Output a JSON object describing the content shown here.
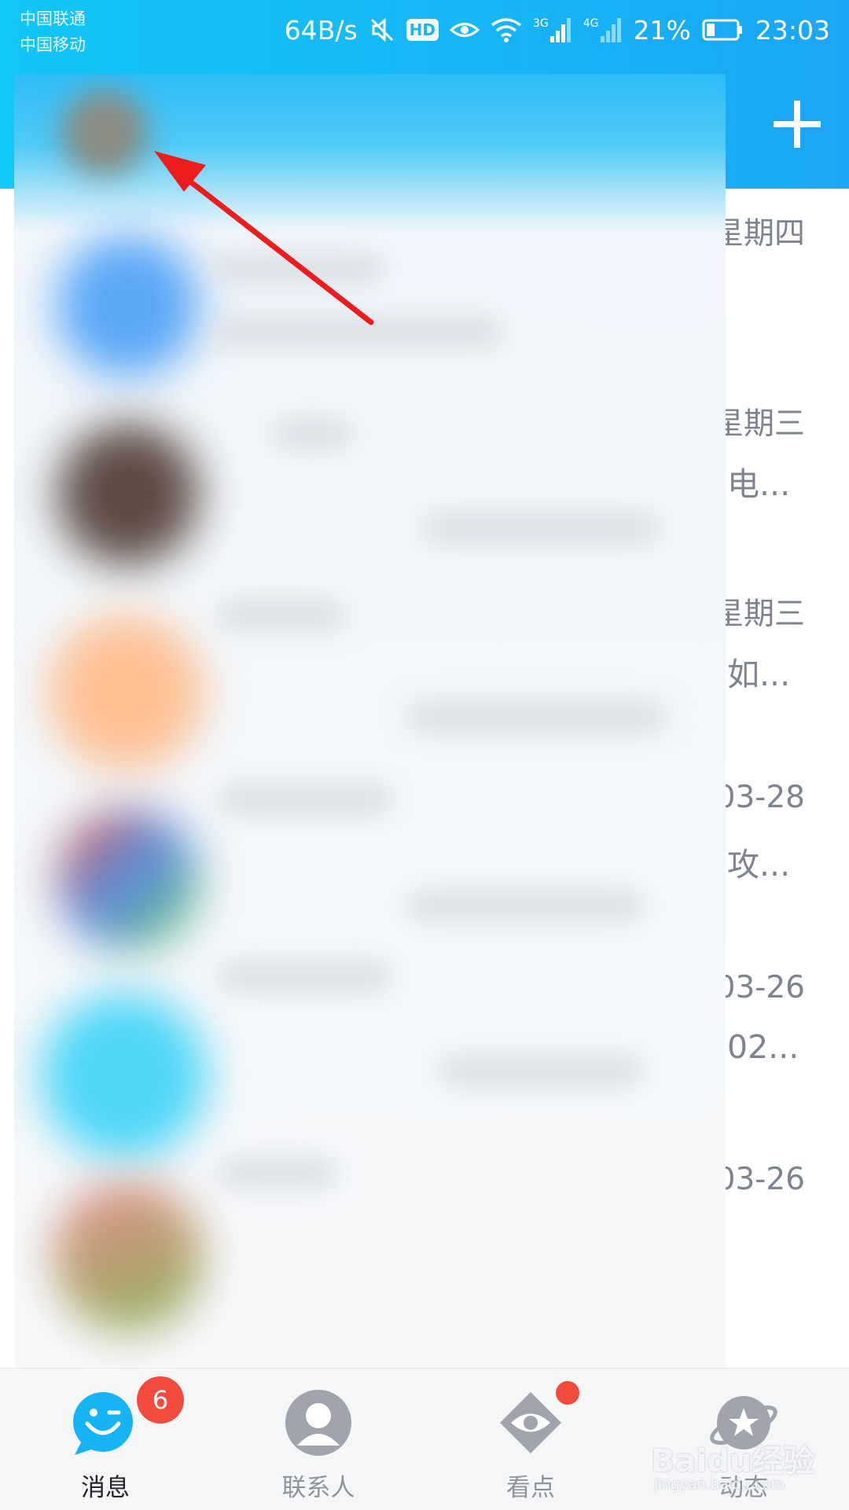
{
  "status_bar": {
    "carrier_1": "中国联通",
    "carrier_2": "中国移动",
    "net_speed": "64B/s",
    "hd_label": "HD",
    "net_3g": "3G",
    "net_4g": "4G",
    "battery": "21%",
    "time": "23:03"
  },
  "header": {
    "add_icon": "plus-icon"
  },
  "messages": [
    {
      "time": "星期四",
      "preview": ""
    },
    {
      "time": "星期三",
      "preview": "电..."
    },
    {
      "time": "星期三",
      "preview": "如..."
    },
    {
      "time": "-03-28",
      "preview": "攻..."
    },
    {
      "time": "-03-26",
      "preview": "02..."
    },
    {
      "time": "-03-26",
      "preview": ""
    }
  ],
  "tabs": [
    {
      "label": "消息",
      "icon": "penguin-chat-icon",
      "badge": "6",
      "active": true
    },
    {
      "label": "联系人",
      "icon": "contacts-icon",
      "active": false
    },
    {
      "label": "看点",
      "icon": "eye-icon",
      "active": false
    },
    {
      "label": "动态",
      "icon": "planet-star-icon",
      "active": false
    }
  ],
  "watermark": {
    "main": "Baidu经验",
    "sub": "jingyan.baidu.com"
  },
  "colors": {
    "header": "#16b6f7",
    "accent_red": "#f24a3d",
    "arrow": "#ee1c1c"
  }
}
